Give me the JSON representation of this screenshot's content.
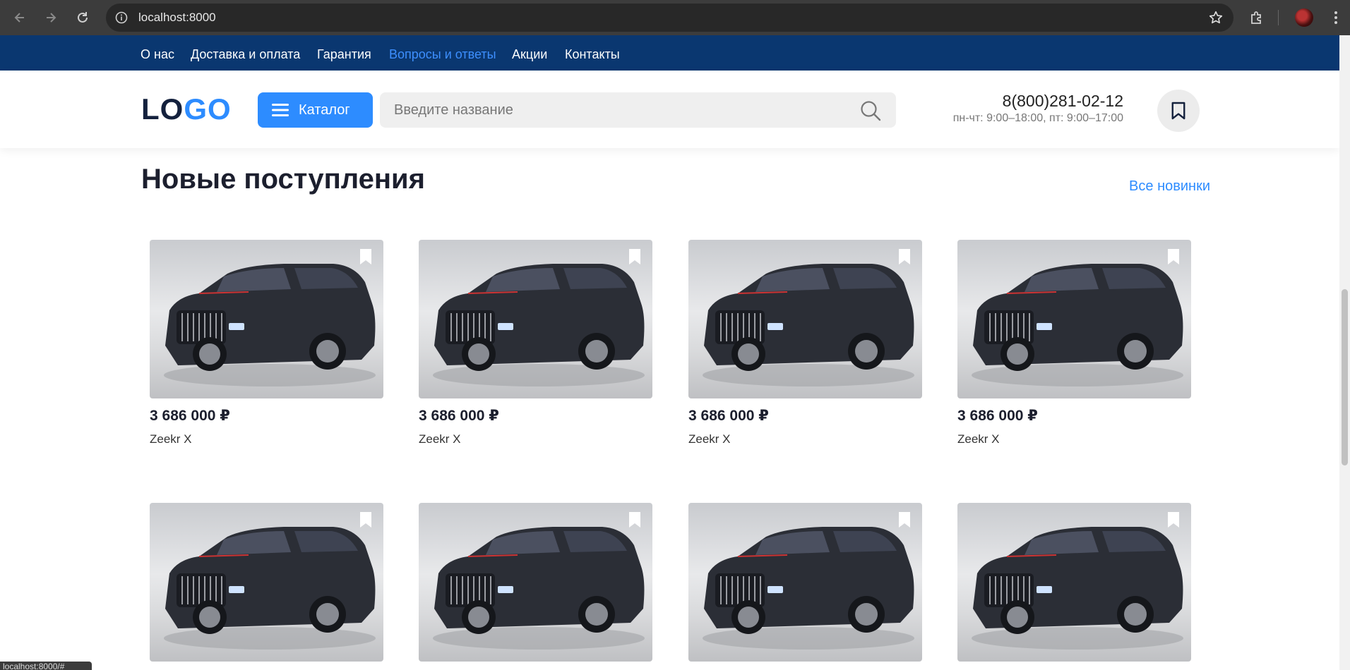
{
  "browser": {
    "url": "localhost:8000",
    "status_url": "localhost:8000/#"
  },
  "topnav": {
    "items": [
      {
        "label": "О нас"
      },
      {
        "label": "Доставка и оплата"
      },
      {
        "label": "Гарантия"
      },
      {
        "label": "Вопросы и ответы",
        "active": true
      },
      {
        "label": "Акции"
      },
      {
        "label": "Контакты"
      }
    ]
  },
  "header": {
    "logo_part1": "LO",
    "logo_part2": "GO",
    "catalog_label": "Каталог",
    "search_placeholder": "Введите название",
    "phone": "8(800)281-02-12",
    "hours": "пн-чт: 9:00–18:00, пт: 9:00–17:00"
  },
  "section": {
    "title": "Новые поступления",
    "all_link": "Все новинки"
  },
  "products": [
    {
      "price": "3 686 000 ₽",
      "name": "Zeekr X"
    },
    {
      "price": "3 686 000 ₽",
      "name": "Zeekr X"
    },
    {
      "price": "3 686 000 ₽",
      "name": "Zeekr X"
    },
    {
      "price": "3 686 000 ₽",
      "name": "Zeekr X"
    },
    {
      "price": "",
      "name": ""
    },
    {
      "price": "",
      "name": ""
    },
    {
      "price": "",
      "name": ""
    },
    {
      "price": "",
      "name": ""
    }
  ],
  "colors": {
    "topnav_bg": "#0a3770",
    "accent": "#2d8cff",
    "active_nav": "#3d8fff"
  },
  "icons": {
    "back": "arrow-left-icon",
    "forward": "arrow-right-icon",
    "reload": "reload-icon",
    "info": "info-icon",
    "star": "star-icon",
    "extensions": "puzzle-icon",
    "menu": "kebab-menu-icon",
    "burger": "burger-icon",
    "search": "search-icon",
    "bookmark": "bookmark-icon"
  }
}
